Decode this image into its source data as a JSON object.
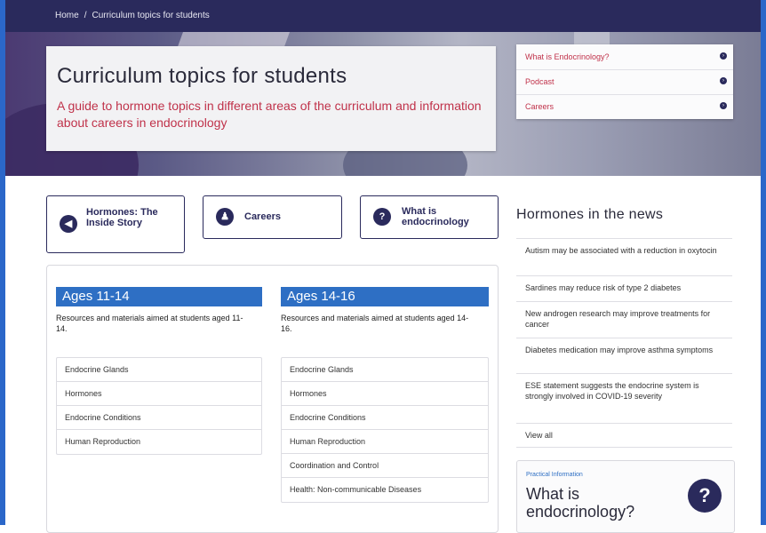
{
  "breadcrumb": {
    "home": "Home",
    "separator": "/",
    "current": "Curriculum topics for students"
  },
  "hero": {
    "title": "Curriculum topics for students",
    "subtitle": "A guide to hormone topics in different areas of the curriculum and information about careers in endocrinology",
    "links": [
      {
        "label": "What is Endocrinology?",
        "icon": "arrow-right-circle-icon"
      },
      {
        "label": "Podcast",
        "icon": "arrow-right-circle-icon"
      },
      {
        "label": "Careers",
        "icon": "arrow-right-circle-icon"
      }
    ]
  },
  "pills": [
    {
      "label": "Hormones: The Inside Story",
      "icon": "megaphone-icon",
      "glyph": "◀"
    },
    {
      "label": "Careers",
      "icon": "person-icon",
      "glyph": "♟"
    },
    {
      "label": "What is endocrinology",
      "icon": "question-icon",
      "glyph": "?"
    }
  ],
  "ages": [
    {
      "heading": "Ages 11-14",
      "description": "Resources and materials aimed at students aged 11-14.",
      "items": [
        "Endocrine Glands",
        "Hormones",
        "Endocrine Conditions",
        "Human Reproduction"
      ]
    },
    {
      "heading": "Ages 14-16",
      "description": "Resources and materials aimed at students aged 14-16.",
      "items": [
        "Endocrine Glands",
        "Hormones",
        "Endocrine Conditions",
        "Human Reproduction",
        "Coordination and Control",
        "Health: Non-communicable Diseases"
      ]
    }
  ],
  "news": {
    "title": "Hormones in the news",
    "items": [
      "Autism may be associated with a reduction in oxytocin",
      "Sardines may reduce risk of type 2 diabetes",
      "New androgen research may improve treatments for cancer",
      "Diabetes medication may improve asthma symptoms",
      "ESE statement suggests the endocrine system is strongly involved in COVID-19 severity",
      "View all"
    ]
  },
  "practical": {
    "kicker": "Practical Information",
    "title": "What is endocrinology?",
    "glyph": "?"
  },
  "colors": {
    "navy": "#2a2a5c",
    "accent_red": "#c0324a",
    "age_blue": "#2e6fc4"
  }
}
